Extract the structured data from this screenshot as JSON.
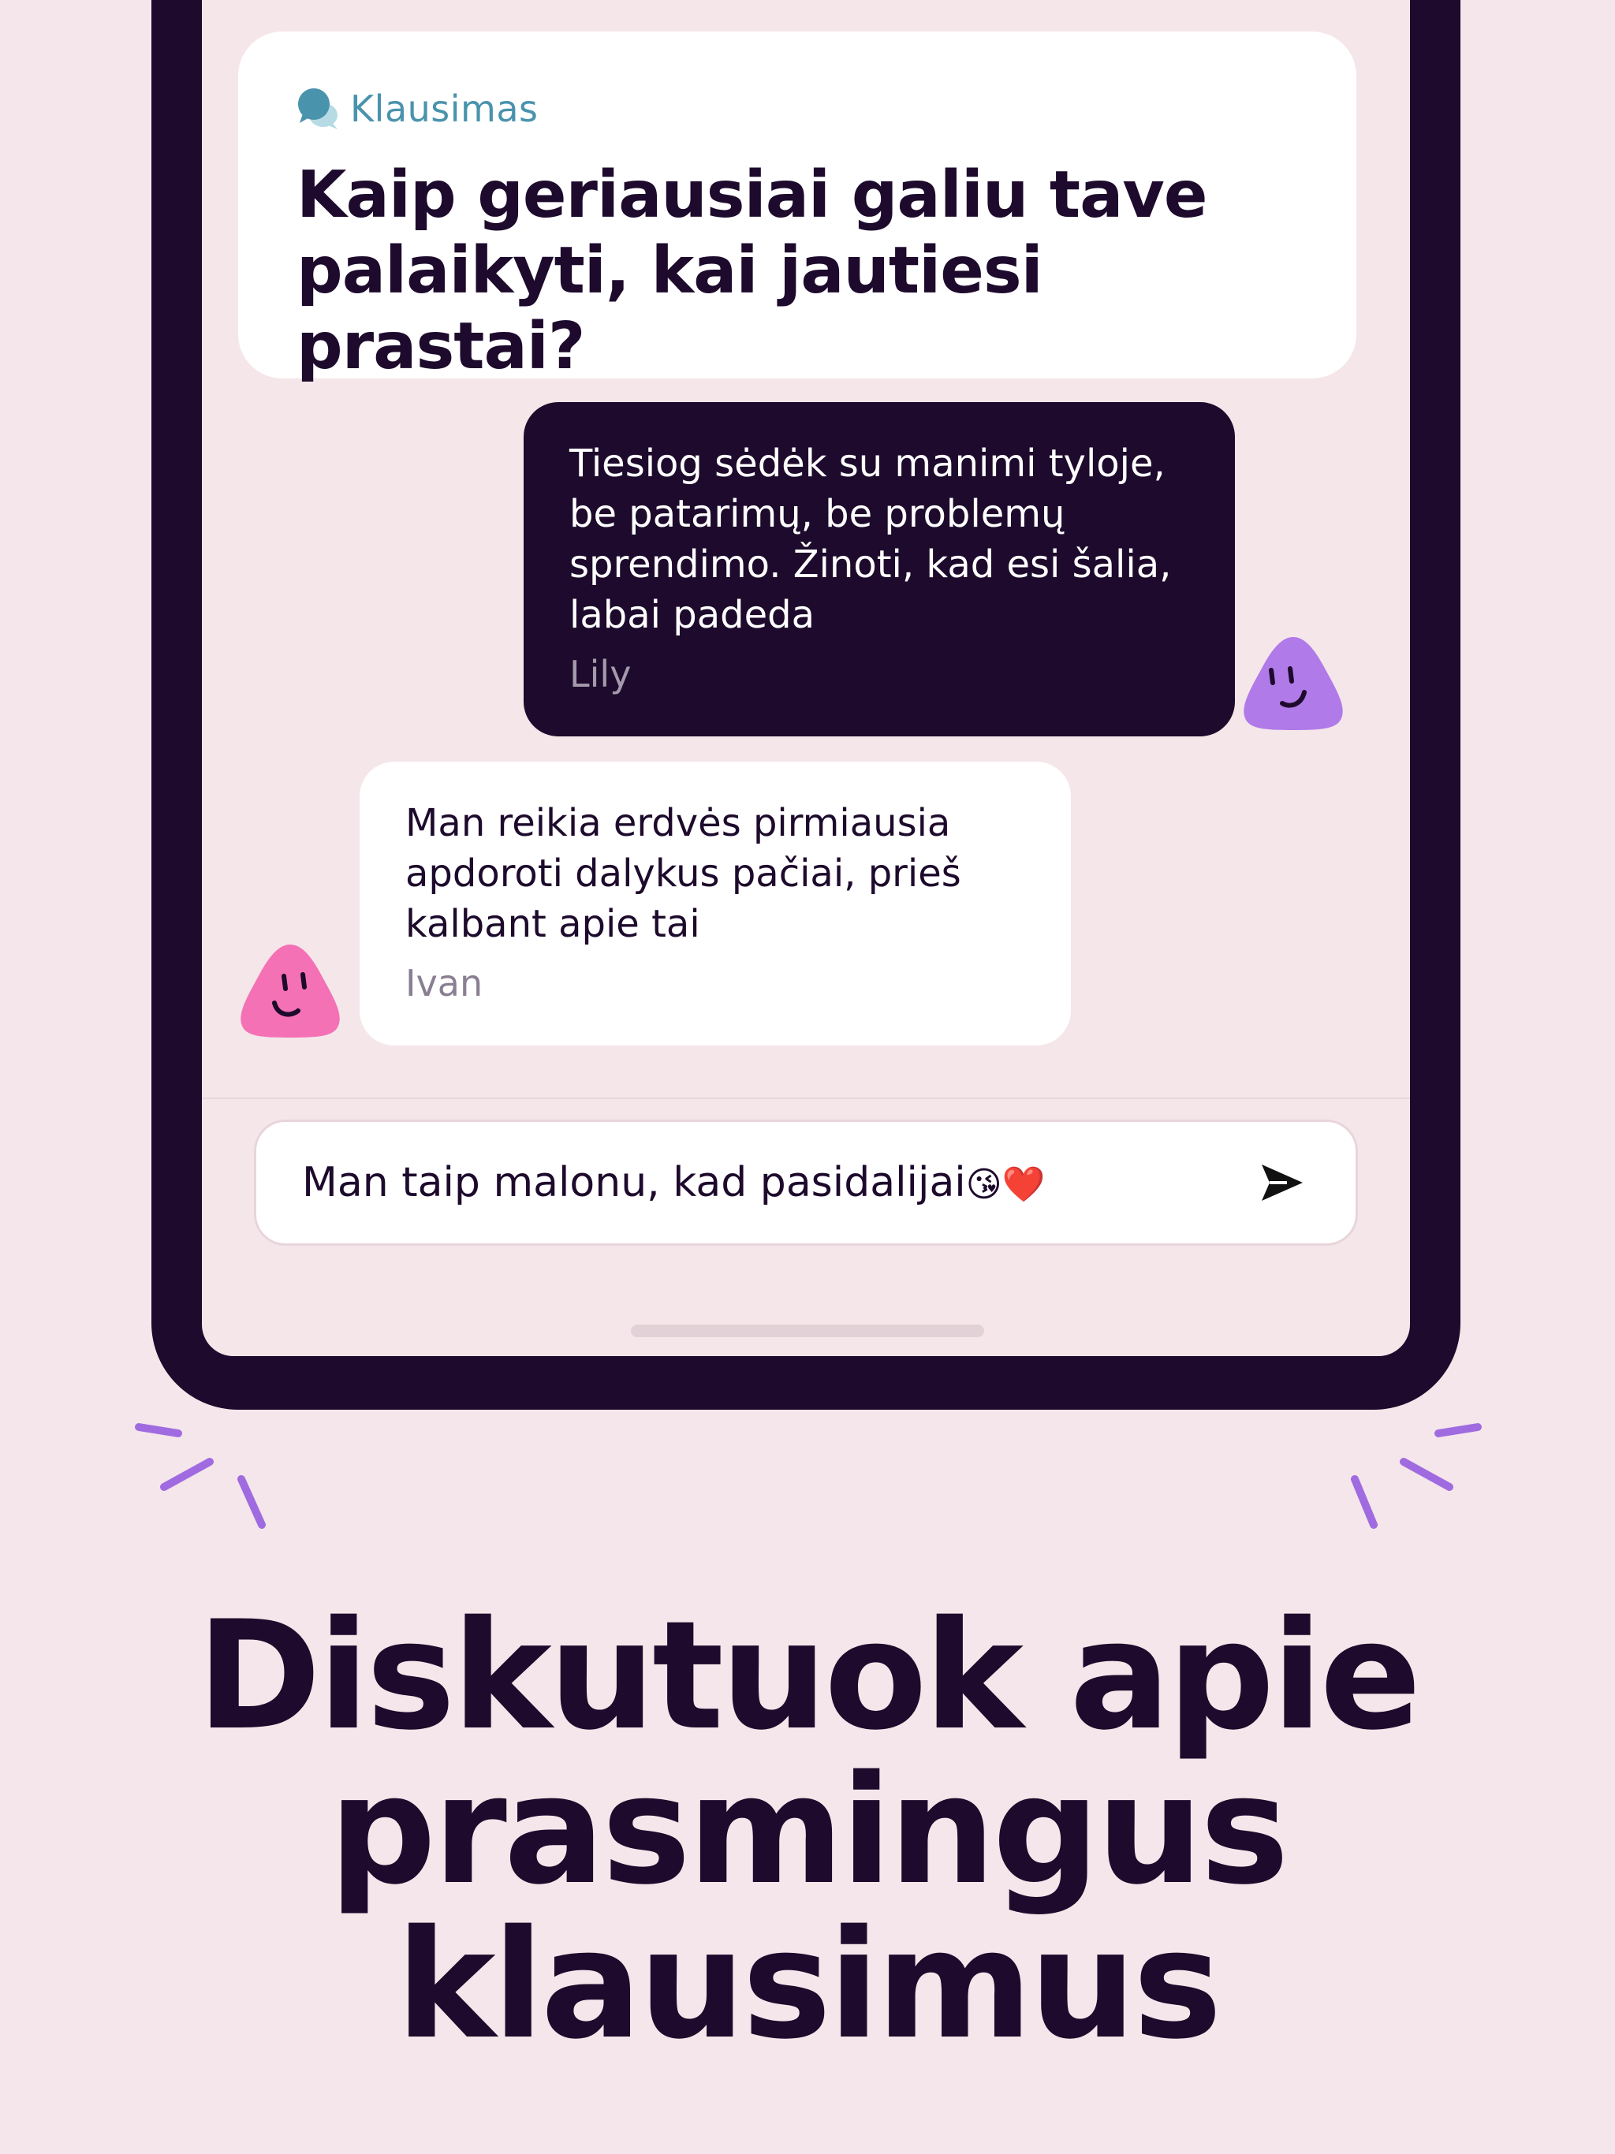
{
  "question": {
    "label": "Klausimas",
    "icon": "chat-bubbles-icon",
    "line1": "Kaip geriausiai galiu tave",
    "line2": "palaikyti, kai jautiesi prastai?"
  },
  "messages": [
    {
      "author": "Lily",
      "lines": [
        "Tiesiog sėdėk su manimi tyloje,",
        "be patarimų, be problemų",
        "sprendimo. Žinoti, kad esi šalia,",
        "labai padeda"
      ],
      "avatar_color": "#b07ae8"
    },
    {
      "author": "Ivan",
      "lines": [
        "Man reikia erdvės pirmiausia",
        "apdoroti dalykus pačiai, prieš",
        "kalbant apie tai"
      ],
      "avatar_color": "#f471b5"
    }
  ],
  "composer": {
    "value": "Man taip malonu, kad pasidalijai",
    "emoji": "😘❤️",
    "send_icon": "send-arrow-icon"
  },
  "headline": {
    "line1": "Diskutuok apie",
    "line2": "prasmingus",
    "line3": "klausimus"
  },
  "colors": {
    "background": "#f4e6ea",
    "ink": "#1d0a2c",
    "accent_purple": "#a06be0",
    "question_label": "#4a93ad"
  }
}
